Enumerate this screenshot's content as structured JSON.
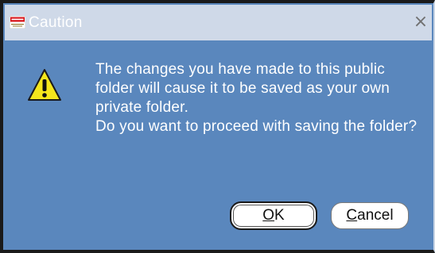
{
  "dialog": {
    "title": "Caution",
    "app_logo_text": "ORACLE",
    "close_glyph": "×",
    "icon": "warning-triangle-icon",
    "message_lines": [
      "The changes you have made to this public folder will cause it to be saved as your own private folder.",
      "Do you want to proceed with saving the folder?"
    ],
    "buttons": {
      "ok": {
        "mnemonic": "O",
        "rest": "K",
        "is_default": true
      },
      "cancel": {
        "mnemonic": "C",
        "rest": "ancel"
      }
    }
  },
  "colors": {
    "dialog_body": "#5a87bd",
    "titlebar": "#cfd9e8",
    "warning_yellow": "#f5e61c"
  }
}
